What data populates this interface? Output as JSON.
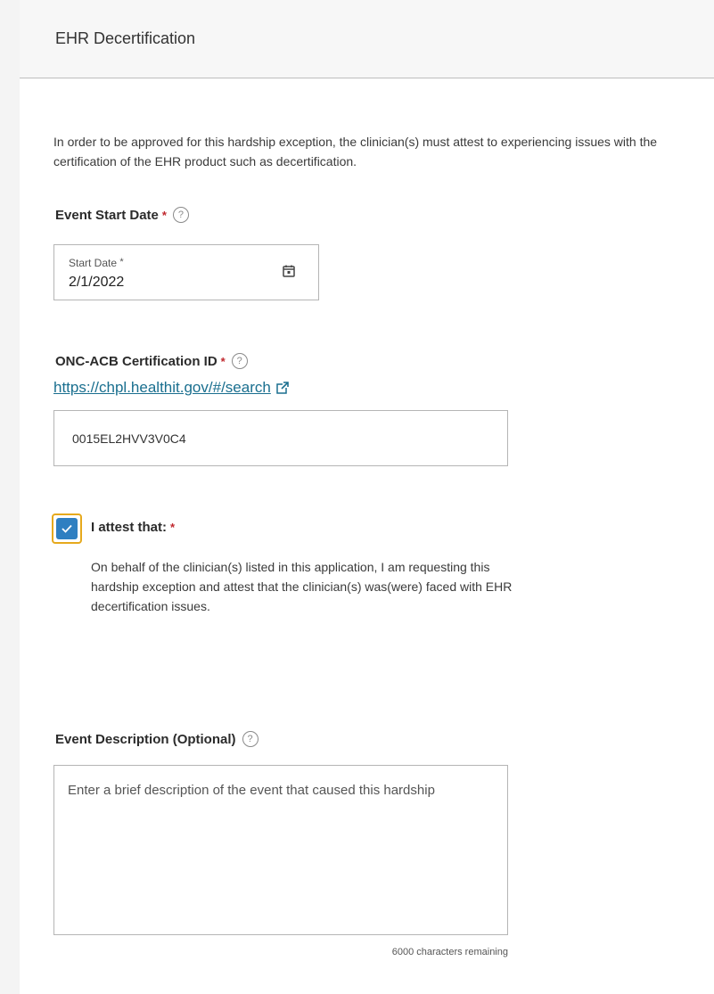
{
  "panel": {
    "title": "EHR Decertification"
  },
  "intro": {
    "text": "In order to be approved for this hardship exception, the clinician(s) must attest to experiencing issues with the certification of the EHR product such as decertification."
  },
  "event_start_date": {
    "label": "Event Start Date",
    "required_mark": "*",
    "help_icon": "question-circle-icon",
    "field_label": "Start Date",
    "field_required_mark": "*",
    "value": "2/1/2022",
    "calendar_icon": "calendar-icon"
  },
  "certification_id": {
    "label": "ONC-ACB Certification ID",
    "required_mark": "*",
    "help_icon": "question-circle-icon",
    "link_text": "https://chpl.healthit.gov/#/search",
    "link_icon": "external-link-icon",
    "value": "0015EL2HVV3V0C4"
  },
  "attest": {
    "checked": true,
    "label": "I attest that:",
    "required_mark": "*",
    "body": "On behalf of the clinician(s) listed in this application, I am requesting this hardship exception and attest that the clinician(s) was(were) faced with EHR decertification issues.",
    "accent_color": "#2f7fc1",
    "focus_color": "#e6a91d"
  },
  "event_description": {
    "label": "Event Description (Optional)",
    "help_icon": "question-circle-icon",
    "value": "",
    "placeholder": "Enter a brief description of the event that caused this hardship",
    "remaining_text": "6000 characters remaining"
  },
  "colors": {
    "required": "#c0272d",
    "link": "#1a6f8f",
    "header_bg": "#f7f7f7"
  }
}
